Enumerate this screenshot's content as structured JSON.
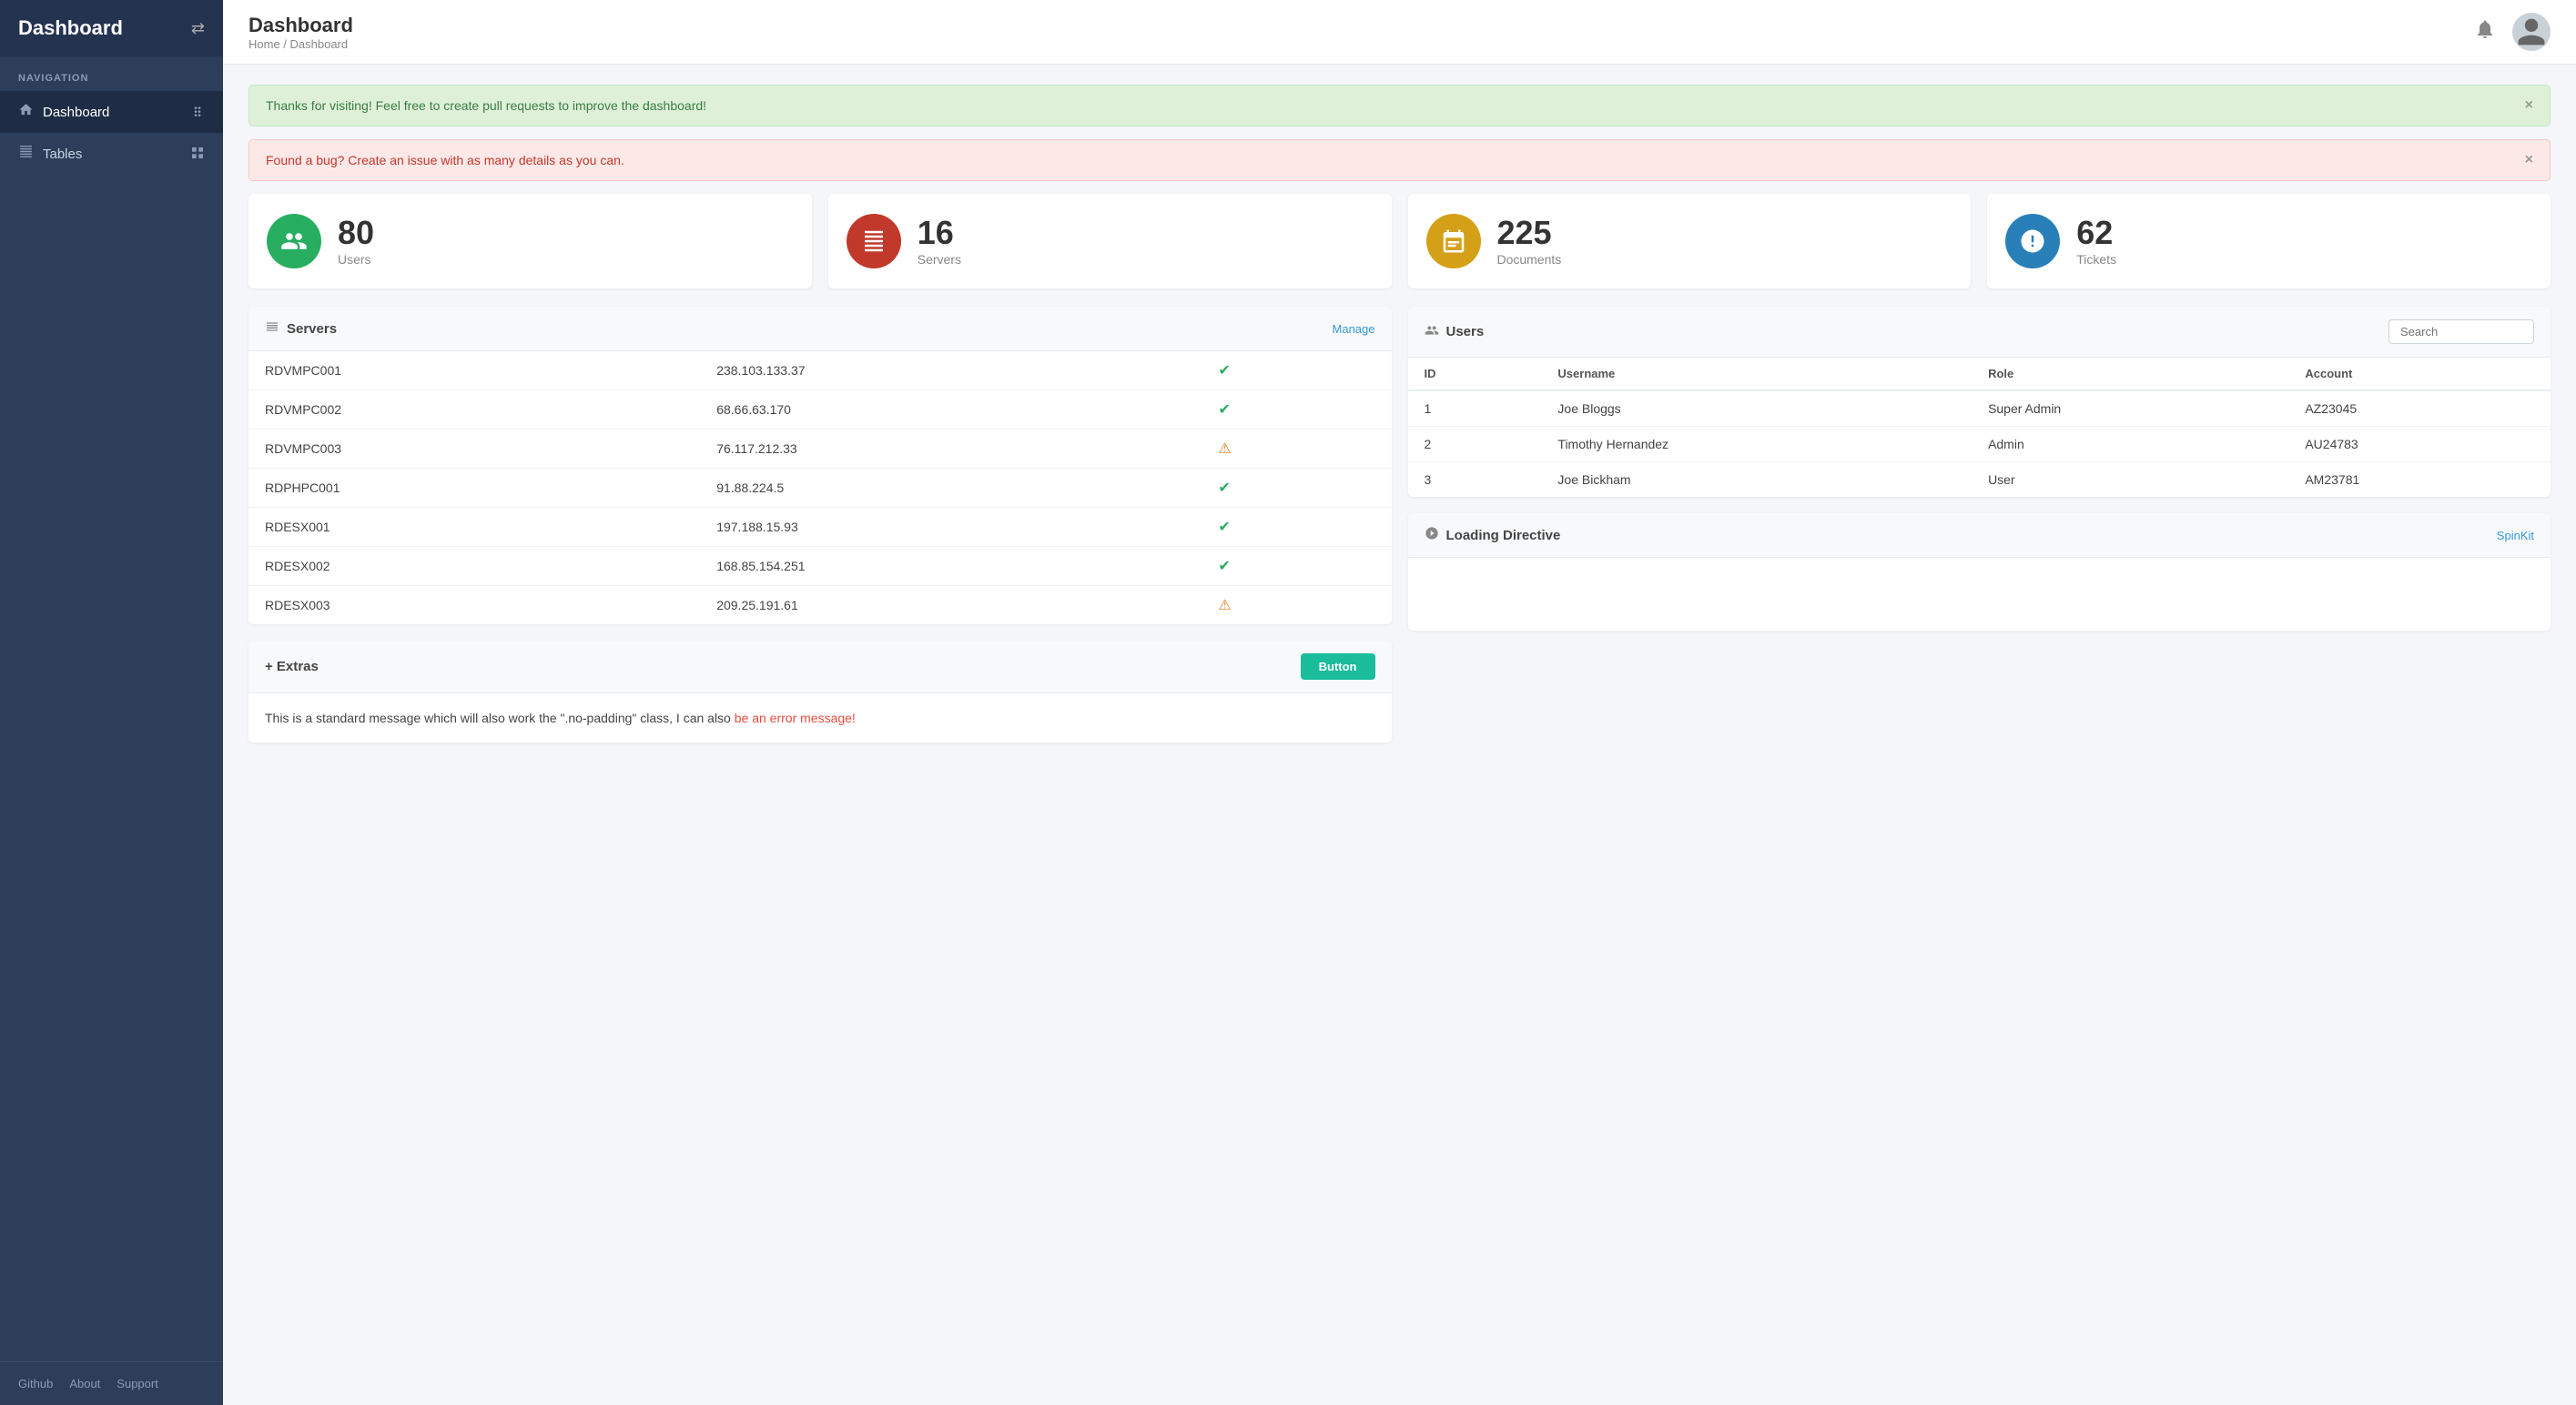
{
  "sidebar": {
    "title": "Dashboard",
    "nav_label": "NAVIGATION",
    "items": [
      {
        "label": "Dashboard",
        "icon": "dashboard",
        "active": true
      },
      {
        "label": "Tables",
        "icon": "tables",
        "active": false
      }
    ],
    "footer": [
      {
        "label": "Github"
      },
      {
        "label": "About"
      },
      {
        "label": "Support"
      }
    ]
  },
  "topbar": {
    "title": "Dashboard",
    "breadcrumb": "Home / Dashboard"
  },
  "alerts": {
    "success_text": "Thanks for visiting! Feel free to create pull requests to improve the dashboard!",
    "danger_text": "Found a bug? Create an issue with as many details as you can."
  },
  "stats": [
    {
      "number": "80",
      "label": "Users",
      "color": "green"
    },
    {
      "number": "16",
      "label": "Servers",
      "color": "red"
    },
    {
      "number": "225",
      "label": "Documents",
      "color": "gold"
    },
    {
      "number": "62",
      "label": "Tickets",
      "color": "blue"
    }
  ],
  "servers_panel": {
    "title": "Servers",
    "action_label": "Manage",
    "servers": [
      {
        "name": "RDVMPC001",
        "ip": "238.103.133.37",
        "status": "ok"
      },
      {
        "name": "RDVMPC002",
        "ip": "68.66.63.170",
        "status": "ok"
      },
      {
        "name": "RDVMPC003",
        "ip": "76.117.212.33",
        "status": "warn"
      },
      {
        "name": "RDPHPC001",
        "ip": "91.88.224.5",
        "status": "ok"
      },
      {
        "name": "RDESX001",
        "ip": "197.188.15.93",
        "status": "ok"
      },
      {
        "name": "RDESX002",
        "ip": "168.85.154.251",
        "status": "ok"
      },
      {
        "name": "RDESX003",
        "ip": "209.25.191.61",
        "status": "warn"
      }
    ]
  },
  "users_panel": {
    "title": "Users",
    "search_placeholder": "Search",
    "columns": [
      "ID",
      "Username",
      "Role",
      "Account"
    ],
    "users": [
      {
        "id": "1",
        "username": "Joe Bloggs",
        "role": "Super Admin",
        "account": "AZ23045"
      },
      {
        "id": "2",
        "username": "Timothy Hernandez",
        "role": "Admin",
        "account": "AU24783"
      },
      {
        "id": "3",
        "username": "Joe Bickham",
        "role": "User",
        "account": "AM23781"
      }
    ]
  },
  "extras_panel": {
    "title": "+ Extras",
    "button_label": "Button",
    "message_text": "This is a standard message which will also work the \".no-padding\" class, I can also ",
    "error_text": "be an error message!"
  },
  "loading_panel": {
    "title": "Loading Directive",
    "action_label": "SpinKit"
  }
}
